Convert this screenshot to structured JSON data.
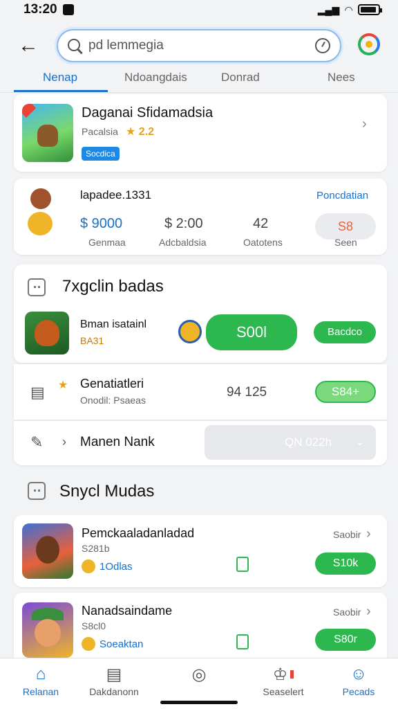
{
  "status": {
    "time": "13:20"
  },
  "search": {
    "placeholder": "pd lemmegia",
    "value": "pd lemmegia"
  },
  "tabs": [
    {
      "label": "Nenap",
      "active": true
    },
    {
      "label": "Ndoangdais",
      "active": false
    },
    {
      "label": "Donrad",
      "active": false
    },
    {
      "label": "Nees",
      "active": false
    }
  ],
  "featured": {
    "title": "Daganai Sfidamadsia",
    "subtitle": "Pacalsia",
    "rating": "★ 2.2",
    "badge": "Socdica"
  },
  "summary": {
    "name": "lapadee.1331",
    "link": "Poncdatian",
    "stat1_value": "$ 9000",
    "stat1_label": "Genmaa",
    "stat2_value": "$ 2:00",
    "stat2_label": "Adcbaldsia",
    "stat3_value": "42",
    "stat3_label": "Oatotens",
    "stat4_value": "S8",
    "stat4_label": "Seen"
  },
  "section1": {
    "title": "7xgclin badas",
    "item_title": "Bman isatainl",
    "item_sub": "BA31",
    "price_button": "S00l",
    "small_button": "Bacdco"
  },
  "row2": {
    "title": "Genatiatleri",
    "sub": "Onodil: Psaeas",
    "value": "94 125",
    "button": "S84+"
  },
  "row3": {
    "title": "Manen Nank",
    "dropdown": "QN 022h"
  },
  "section2": {
    "title": "Snycl Mudas"
  },
  "list": [
    {
      "title": "Pemckaaladanladad",
      "sub": "S281b",
      "meta": "1Odlas",
      "side": "Saobir",
      "button": "S10k"
    },
    {
      "title": "Nanadsaindame",
      "sub": "S8cl0",
      "meta": "Soeaktan",
      "side": "Saobir",
      "button": "S80r"
    }
  ],
  "nav": [
    {
      "label": "Relanan",
      "active": true,
      "icon": "home-icon"
    },
    {
      "label": "Dakdanonn",
      "active": false,
      "icon": "document-icon"
    },
    {
      "label": "",
      "active": false,
      "icon": "compass-icon"
    },
    {
      "label": "Seaselert",
      "active": false,
      "icon": "bell-icon"
    },
    {
      "label": "Pecads",
      "active": false,
      "icon": "users-icon"
    }
  ],
  "colors": {
    "accent": "#1a6fc9",
    "green": "#2db84f",
    "background": "#f2f3f5"
  }
}
